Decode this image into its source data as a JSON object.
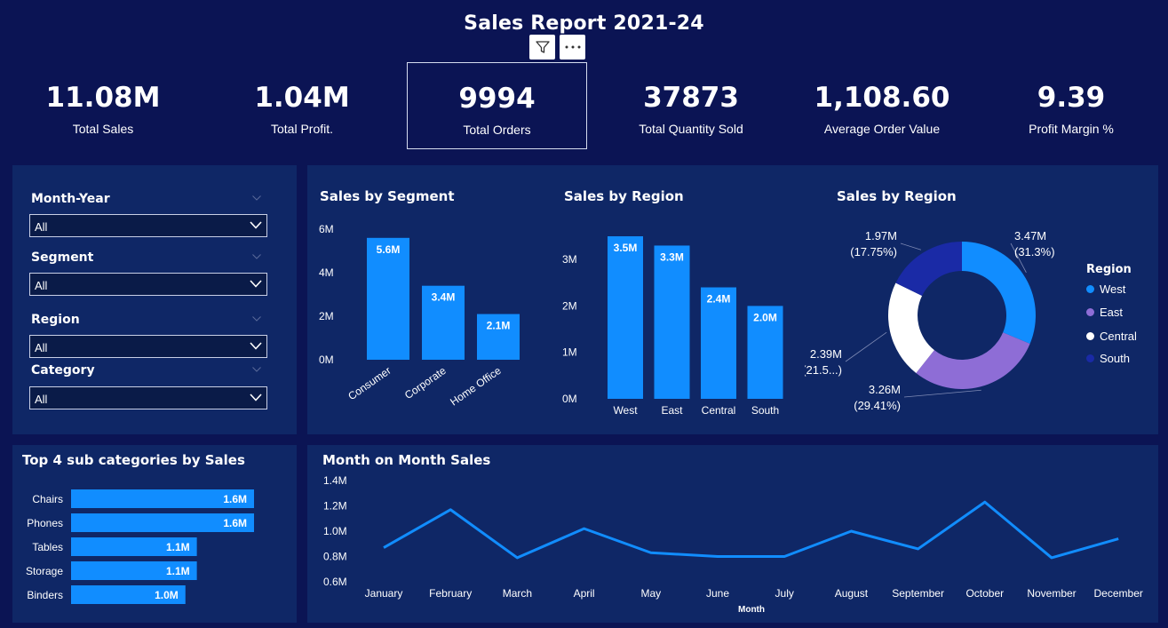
{
  "header": {
    "title": "Sales Report 2021-24"
  },
  "colors": {
    "background": "#0b1454",
    "panel": "#0f2766",
    "bar": "#118dff",
    "west": "#118dff",
    "east": "#8e6dd6",
    "central": "#ffffff",
    "south": "#1a2aa6"
  },
  "kpis": [
    {
      "value": "11.08M",
      "label": "Total Sales"
    },
    {
      "value": "1.04M",
      "label": "Total Profit."
    },
    {
      "value": "9994",
      "label": "Total Orders"
    },
    {
      "value": "37873",
      "label": "Total Quantity Sold"
    },
    {
      "value": "1,108.60",
      "label": "Average Order Value"
    },
    {
      "value": "9.39",
      "label": "Profit Margin %"
    }
  ],
  "slicers": [
    {
      "label": "Month-Year",
      "value": "All"
    },
    {
      "label": "Segment",
      "value": "All"
    },
    {
      "label": "Region",
      "value": "All"
    },
    {
      "label": "Category",
      "value": "All"
    }
  ],
  "icons": {
    "filter": "filter-icon",
    "more": "more-options-icon",
    "dropdown": "chevron-down-icon"
  },
  "chart_data": [
    {
      "id": "segment",
      "type": "bar",
      "title": "Sales by Segment",
      "categories": [
        "Consumer",
        "Corporate",
        "Home Office"
      ],
      "values": [
        5.6,
        3.4,
        2.1
      ],
      "data_labels": [
        "5.6M",
        "3.4M",
        "2.1M"
      ],
      "yticks": [
        "0M",
        "2M",
        "4M",
        "6M"
      ],
      "ylim": [
        0,
        6
      ]
    },
    {
      "id": "region_bar",
      "type": "bar",
      "title": "Sales by Region",
      "categories": [
        "West",
        "East",
        "Central",
        "South"
      ],
      "values": [
        3.5,
        3.3,
        2.4,
        2.0
      ],
      "data_labels": [
        "3.5M",
        "3.3M",
        "2.4M",
        "2.0M"
      ],
      "yticks": [
        "0M",
        "1M",
        "2M",
        "3M"
      ],
      "ylim": [
        0,
        3.5
      ]
    },
    {
      "id": "region_donut",
      "type": "pie",
      "title": "Sales by Region",
      "legend_title": "Region",
      "categories": [
        "West",
        "East",
        "Central",
        "South"
      ],
      "values": [
        3.47,
        3.26,
        2.39,
        1.97
      ],
      "value_labels": [
        "3.47M",
        "3.26M",
        "2.39M",
        "1.97M"
      ],
      "percent_labels": [
        "(31.3%)",
        "(29.41%)",
        "(21.5...)",
        "(17.75%)"
      ],
      "legend": "right"
    },
    {
      "id": "subcategories",
      "type": "bar",
      "title": "Top 4 sub categories by Sales",
      "categories": [
        "Chairs",
        "Phones",
        "Tables",
        "Storage",
        "Binders"
      ],
      "values": [
        1.6,
        1.6,
        1.1,
        1.1,
        1.0
      ],
      "data_labels": [
        "1.6M",
        "1.6M",
        "1.1M",
        "1.1M",
        "1.0M"
      ],
      "orientation": "horizontal"
    },
    {
      "id": "monthly",
      "type": "line",
      "title": "Month on Month Sales",
      "xlabel": "Month",
      "categories": [
        "January",
        "February",
        "March",
        "April",
        "May",
        "June",
        "July",
        "August",
        "September",
        "October",
        "November",
        "December"
      ],
      "values": [
        0.87,
        1.17,
        0.79,
        1.02,
        0.83,
        0.8,
        0.8,
        1.0,
        0.86,
        1.23,
        0.79,
        0.94
      ],
      "yticks": [
        "0.6M",
        "0.8M",
        "1.0M",
        "1.2M",
        "1.4M"
      ],
      "ylim": [
        0.6,
        1.4
      ]
    }
  ]
}
